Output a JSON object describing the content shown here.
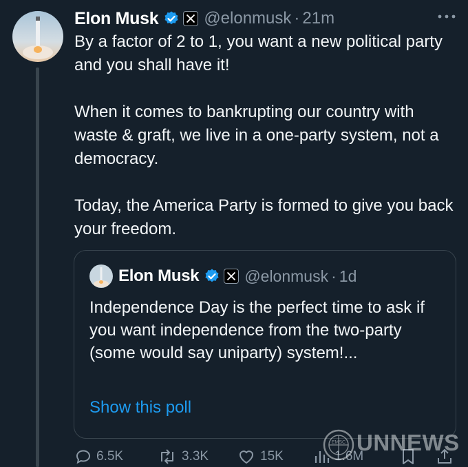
{
  "main_tweet": {
    "author_name": "Elon Musk",
    "handle": "@elonmusk",
    "separator": "·",
    "time": "21m",
    "paragraphs": [
      "By a factor of 2 to 1, you want a new political party and you shall have it!",
      "When it comes to bankrupting our country with waste & graft, we live in a one-party system, not a democracy.",
      "Today, the America Party is formed to give you back your freedom."
    ],
    "more_icon": "more-horizontal-icon",
    "verified_icon": "verified-badge-icon",
    "affiliation_icon": "x-logo-icon"
  },
  "quoted_tweet": {
    "author_name": "Elon Musk",
    "handle": "@elonmusk",
    "separator": "·",
    "time": "1d",
    "text": "Independence Day is the perfect time to ask if you want independence from the two-party (some would say uniparty) system!...",
    "poll_link": "Show this poll"
  },
  "actions": {
    "replies": "6.5K",
    "reposts": "3.3K",
    "likes": "15K",
    "views": "1.6M"
  },
  "watermark": {
    "text": "UNNEWS",
    "seal_text": "EMSC"
  },
  "colors": {
    "background": "#15202b",
    "text": "#f2f5f7",
    "secondary": "#8b98a5",
    "link": "#1d9bf0",
    "verified": "#1d9bf0",
    "border": "#38444d"
  }
}
